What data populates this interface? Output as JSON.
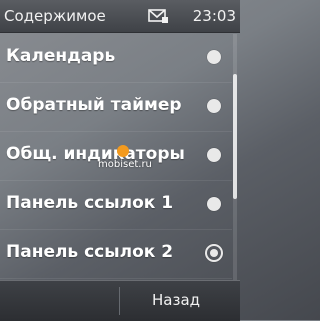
{
  "statusbar": {
    "title": "Содержимое",
    "time": "23:03",
    "icons": [
      "mail-icon"
    ]
  },
  "list": {
    "items": [
      {
        "label": "Календарь",
        "selected": false
      },
      {
        "label": "Обратный таймер",
        "selected": false
      },
      {
        "label": "Общ. индикаторы",
        "selected": false
      },
      {
        "label": "Панель ссылок 1",
        "selected": false
      },
      {
        "label": "Панель ссылок 2",
        "selected": true
      }
    ]
  },
  "watermark": {
    "text": "mobiset.ru"
  },
  "softkeys": {
    "right_label": "Назад"
  },
  "colors": {
    "accent": "#f39a1e",
    "text": "#ffffff"
  }
}
